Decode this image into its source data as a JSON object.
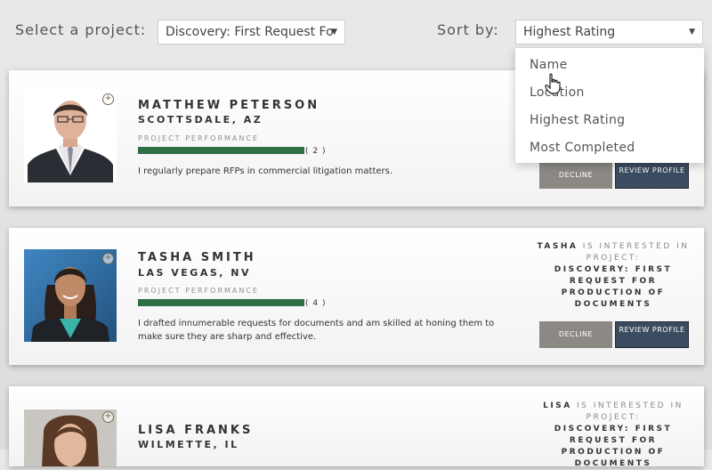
{
  "toolbar": {
    "project_label": "Select a project:",
    "project_value": "Discovery: First Request Fo",
    "sort_label": "Sort by:",
    "sort_value": "Highest Rating"
  },
  "sort_options": [
    "Name",
    "Location",
    "Highest Rating",
    "Most Completed"
  ],
  "attorneys": [
    {
      "name": "MATTHEW PETERSON",
      "location": "SCOTTSDALE, AZ",
      "performance_label": "PROJECT PERFORMANCE",
      "count": "( 2 )",
      "description": "I regularly prepare RFPs in commercial litigation matters.",
      "decline": "DECLINE",
      "review": "REVIEW PROFILE"
    },
    {
      "name": "TASHA SMITH",
      "location": "LAS VEGAS, NV",
      "performance_label": "PROJECT PERFORMANCE",
      "count": "( 4 )",
      "description": "I drafted innumerable requests for documents and am skilled at honing them to make sure they are sharp and effective.",
      "interest_name": "TASHA",
      "interest_text": " IS INTERESTED IN PROJECT:",
      "interest_project": "DISCOVERY: FIRST REQUEST FOR PRODUCTION OF DOCUMENTS",
      "decline": "DECLINE",
      "review": "REVIEW PROFILE"
    },
    {
      "name": "LISA FRANKS",
      "location": "WILMETTE, IL",
      "interest_name": "LISA",
      "interest_text": " IS INTERESTED IN PROJECT:",
      "interest_project": "DISCOVERY: FIRST REQUEST FOR PRODUCTION OF DOCUMENTS"
    }
  ],
  "colors": {
    "performance_bar": "#2f6f46",
    "decline_button": "#8c8985",
    "review_button": "#3b4b60"
  }
}
